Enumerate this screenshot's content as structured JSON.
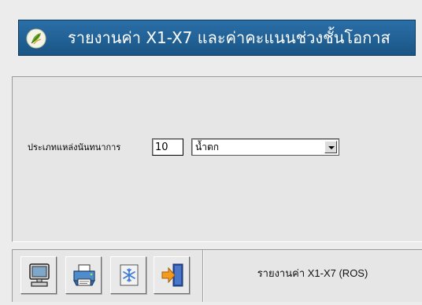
{
  "title_bar": {
    "logo_icon": "leaf-logo-icon",
    "title": "รายงานค่า X1-X7 และค่าคะแนนช่วงชั้นโอกาส"
  },
  "form": {
    "type_label": "ประเภทแหล่งนันทนาการ",
    "code_value": "10",
    "selected_option": "น้ำตก"
  },
  "toolbar": {
    "buttons": [
      {
        "icon": "monitor-icon"
      },
      {
        "icon": "printer-icon"
      },
      {
        "icon": "snowflake-icon"
      },
      {
        "icon": "exit-door-icon"
      }
    ],
    "report_name": "รายงานค่า X1-X7 (ROS)"
  },
  "colors": {
    "title_bar_bg": "#1f5f95",
    "title_text": "#ffffff",
    "panel_bg": "#e6e6e6"
  }
}
